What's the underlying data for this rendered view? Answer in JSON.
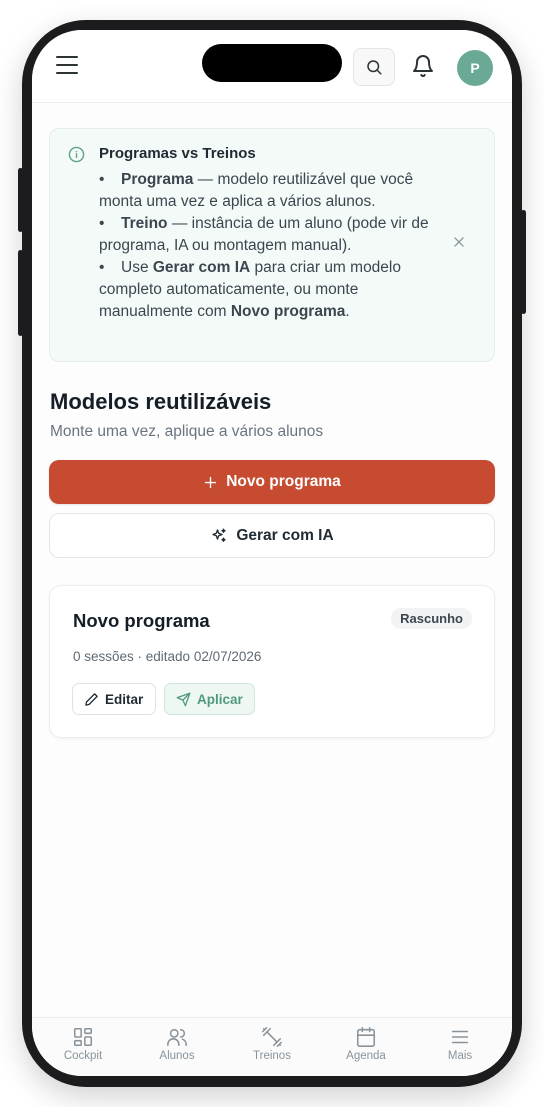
{
  "header": {
    "avatar_initial": "P"
  },
  "info": {
    "title": "Programas vs Treinos",
    "items": [
      {
        "bold": "Programa",
        "text": " — modelo reutilizável que você monta uma vez e aplica a vários alunos."
      },
      {
        "bold": "Treino",
        "text": " — instância de um aluno (pode vir de programa, IA ou montagem manual)."
      },
      {
        "pre": "Use ",
        "bold": "Gerar com IA",
        "mid": " para criar um modelo completo automaticamente, ou monte manualmente com ",
        "bold2": "Novo programa",
        "post": "."
      }
    ]
  },
  "section": {
    "title": "Modelos reutilizáveis",
    "subtitle": "Monte uma vez, aplique a vários alunos"
  },
  "actions": {
    "new_label": "Novo programa",
    "ai_label": "Gerar com IA"
  },
  "card": {
    "title": "Novo programa",
    "badge": "Rascunho",
    "meta": "0 sessões · editado 02/07/2026",
    "edit_label": "Editar",
    "apply_label": "Aplicar"
  },
  "nav": {
    "items": [
      {
        "label": "Cockpit",
        "icon": "grid-icon"
      },
      {
        "label": "Alunos",
        "icon": "users-icon"
      },
      {
        "label": "Treinos",
        "icon": "dumbbell-icon"
      },
      {
        "label": "Agenda",
        "icon": "calendar-icon"
      },
      {
        "label": "Mais",
        "icon": "menu-icon"
      }
    ]
  },
  "colors": {
    "accent": "#c64b30",
    "avatar": "#6aa995",
    "apply": "#4f9a7d"
  }
}
